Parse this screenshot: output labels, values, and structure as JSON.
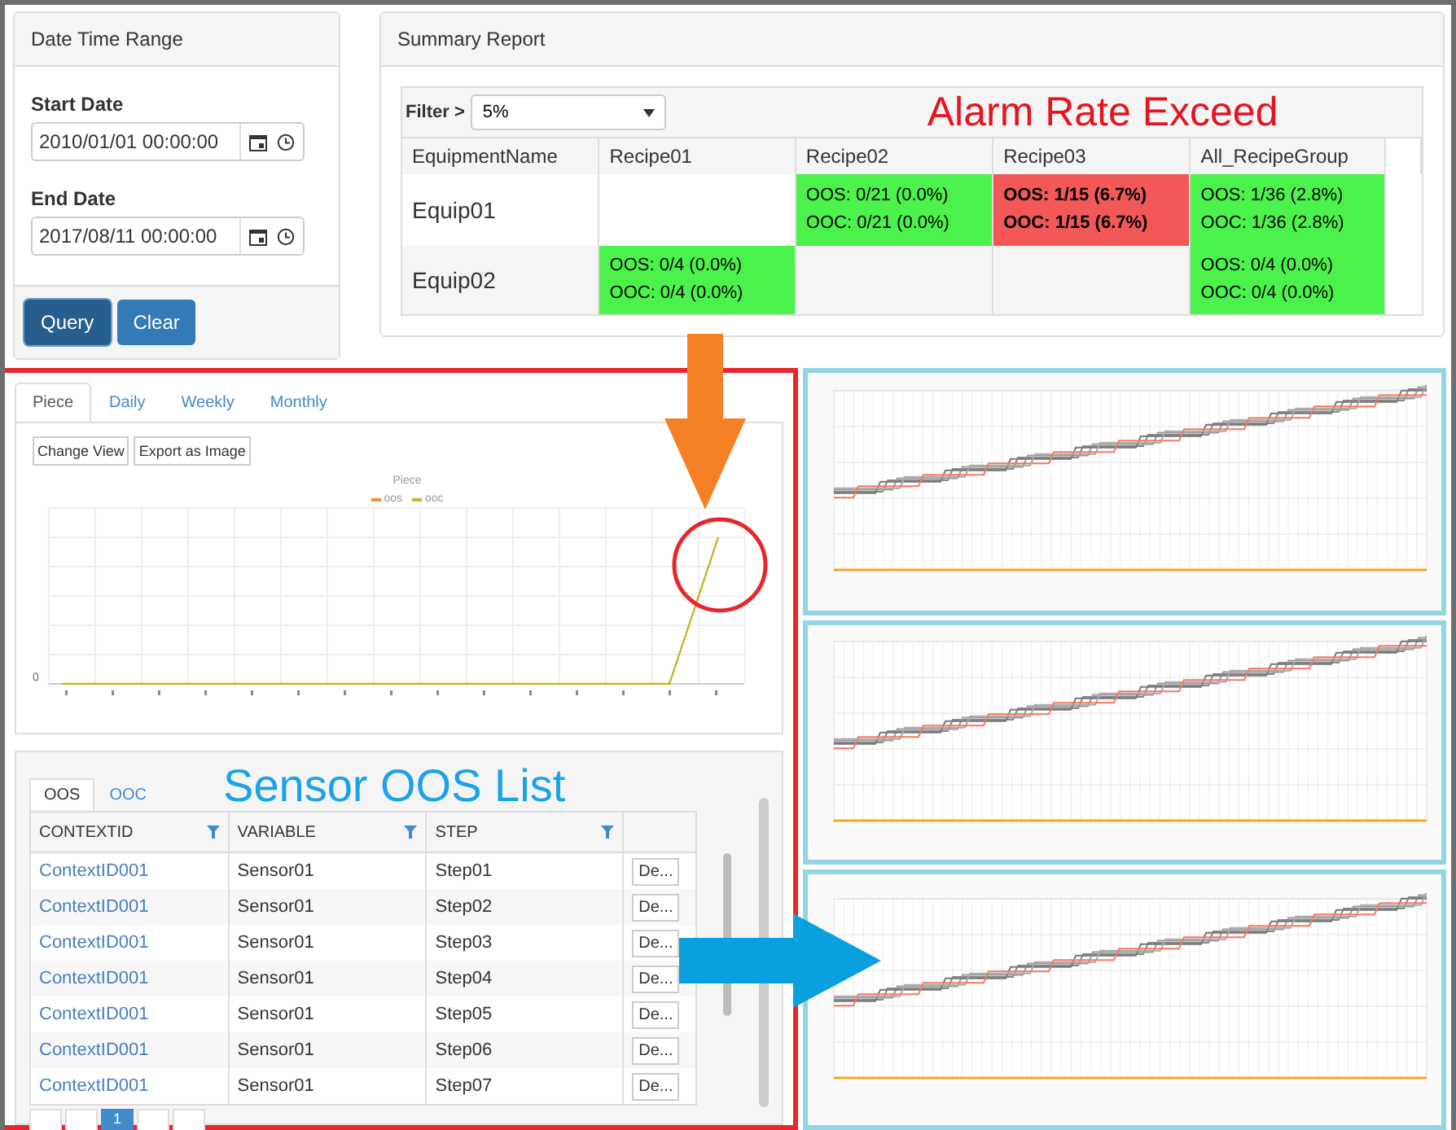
{
  "date_panel": {
    "title": "Date Time Range",
    "fields": [
      {
        "label": "Start Date",
        "value": "2010/01/01 00:00:00"
      },
      {
        "label": "End Date",
        "value": "2017/08/11 00:00:00"
      }
    ],
    "buttons": [
      {
        "label": "Query",
        "selected": true
      },
      {
        "label": "Clear",
        "selected": false
      }
    ]
  },
  "summary": {
    "title": "Summary Report",
    "filter_label": "Filter >",
    "filter_value": "5%",
    "annotation": "Alarm Rate Exceed",
    "columns": [
      "EquipmentName",
      "Recipe01",
      "Recipe02",
      "Recipe03",
      "All_RecipeGroup"
    ],
    "rows": [
      {
        "cells": [
          "Equip01",
          "",
          {
            "color": "#4cf24c",
            "alarm": false,
            "oos": "OOS: 0/21 (0.0%)",
            "ooc": "OOC: 0/21 (0.0%)"
          },
          {
            "color": "#f35858",
            "alarm": true,
            "oos": "OOS: 1/15 (6.7%)",
            "ooc": "OOC: 1/15 (6.7%)"
          },
          {
            "color": "#4cf24c",
            "alarm": false,
            "oos": "OOS: 1/36 (2.8%)",
            "ooc": "OOC: 1/36 (2.8%)"
          }
        ]
      },
      {
        "cells": [
          "Equip02",
          {
            "color": "#4cf24c",
            "alarm": false,
            "oos": "OOS: 0/4 (0.0%)",
            "ooc": "OOC: 0/4 (0.0%)"
          },
          "",
          "",
          {
            "color": "#4cf24c",
            "alarm": false,
            "oos": "OOS: 0/4 (0.0%)",
            "ooc": "OOC: 0/4 (0.0%)"
          }
        ]
      }
    ]
  },
  "detail": {
    "tabs": [
      {
        "label": "Piece",
        "selected": true
      },
      {
        "label": "Daily",
        "selected": false
      },
      {
        "label": "Weekly",
        "selected": false
      },
      {
        "label": "Monthly",
        "selected": false
      }
    ],
    "buttons": [
      "Change View",
      "Export as Image"
    ],
    "chart": {
      "title": "Piece",
      "legend": [
        {
          "name": "oos",
          "color": "#f58a3c"
        },
        {
          "name": "ooc",
          "color": "#c8b432"
        }
      ],
      "y_tick": "0"
    },
    "list_annotation": "Sensor OOS List",
    "list_tabs": [
      {
        "label": "OOS",
        "selected": true
      },
      {
        "label": "OOC",
        "selected": false
      }
    ],
    "columns": [
      "CONTEXTID",
      "VARIABLE",
      "STEP"
    ],
    "rows": [
      {
        "context": "ContextID001",
        "variable": "Sensor01",
        "step": "Step01",
        "action": "De..."
      },
      {
        "context": "ContextID001",
        "variable": "Sensor01",
        "step": "Step02",
        "action": "De..."
      },
      {
        "context": "ContextID001",
        "variable": "Sensor01",
        "step": "Step03",
        "action": "De..."
      },
      {
        "context": "ContextID001",
        "variable": "Sensor01",
        "step": "Step04",
        "action": "De..."
      },
      {
        "context": "ContextID001",
        "variable": "Sensor01",
        "step": "Step05",
        "action": "De..."
      },
      {
        "context": "ContextID001",
        "variable": "Sensor01",
        "step": "Step06",
        "action": "De..."
      },
      {
        "context": "ContextID001",
        "variable": "Sensor01",
        "step": "Step07",
        "action": "De..."
      }
    ],
    "current_page": "1"
  },
  "trend_charts": [
    {
      "kind": "step_lines"
    },
    {
      "kind": "step_lines"
    },
    {
      "kind": "step_lines"
    }
  ]
}
